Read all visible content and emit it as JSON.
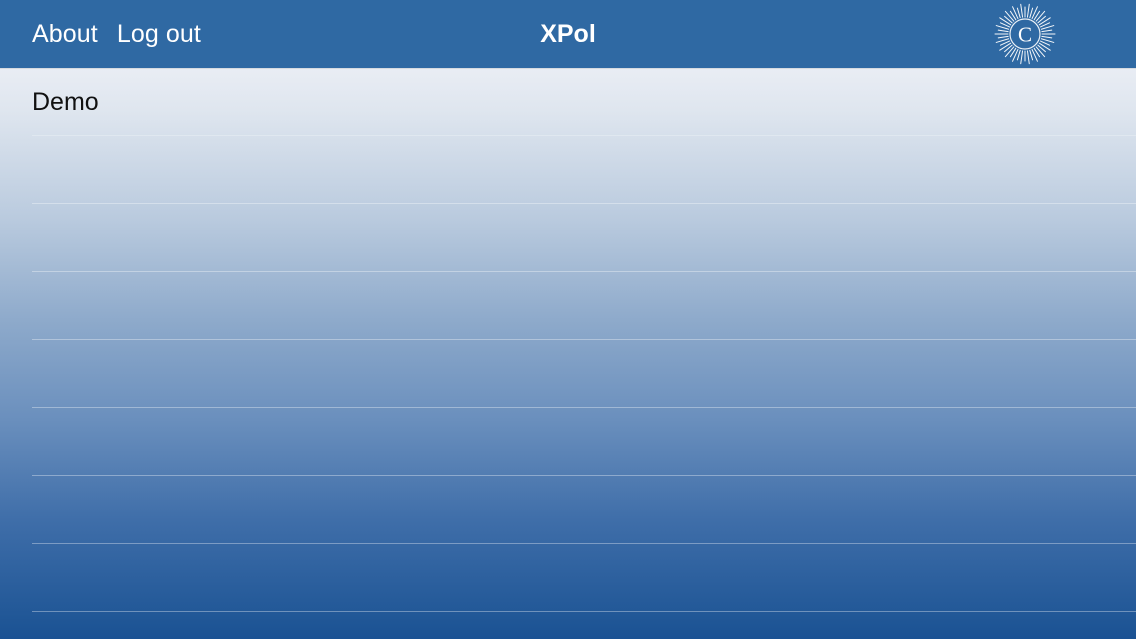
{
  "navbar": {
    "about_label": "About",
    "logout_label": "Log out",
    "title": "XPol",
    "logo_letter": "C",
    "logo_icon": "sunburst-logo-icon"
  },
  "list": {
    "rows": [
      {
        "label": "Demo"
      },
      {
        "label": ""
      },
      {
        "label": ""
      },
      {
        "label": ""
      },
      {
        "label": ""
      },
      {
        "label": ""
      },
      {
        "label": ""
      },
      {
        "label": ""
      }
    ]
  },
  "colors": {
    "navbar_bg": "#2f69a3",
    "gradient_top": "#e9edf4",
    "gradient_bottom": "#1a5293",
    "nav_text": "#ffffff",
    "row_text": "#111111"
  }
}
